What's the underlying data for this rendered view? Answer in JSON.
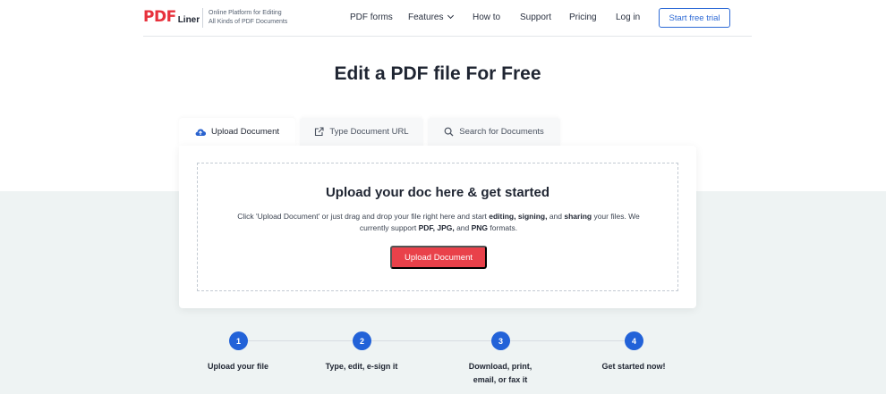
{
  "header": {
    "logo_pdf": "PDF",
    "logo_liner": "Liner",
    "tagline_line1": "Online Platform for Editing",
    "tagline_line2": "All Kinds of PDF Documents",
    "nav": [
      {
        "label": "PDF forms"
      },
      {
        "label": "Features"
      },
      {
        "label": "How to"
      },
      {
        "label": "Support"
      },
      {
        "label": "Pricing"
      },
      {
        "label": "Log in"
      }
    ],
    "cta_label": "Start free trial"
  },
  "hero": {
    "title": "Edit a PDF file For Free"
  },
  "tabs": [
    {
      "label": "Upload Document",
      "icon": "cloud-upload-icon",
      "active": true
    },
    {
      "label": "Type Document URL",
      "icon": "external-link-icon",
      "active": false
    },
    {
      "label": "Search for Documents",
      "icon": "search-icon",
      "active": false
    }
  ],
  "upload": {
    "title": "Upload your doc here & get started",
    "text_1": "Click 'Upload Document' or just drag and drop your file right here and start ",
    "bold_editing": "editing,",
    "bold_signing": "signing,",
    "text_and": " and ",
    "bold_sharing": "sharing",
    "text_2": " your files. We currently support ",
    "bold_pdf": "PDF, JPG,",
    "text_3": " and ",
    "bold_png": "PNG",
    "text_4": " formats.",
    "button_label": "Upload Document"
  },
  "steps": [
    {
      "number": "1",
      "label": "Upload your file"
    },
    {
      "number": "2",
      "label": "Type, edit, e-sign it"
    },
    {
      "number": "3",
      "label": "Download, print, email, or fax it"
    },
    {
      "number": "4",
      "label": "Get started now!"
    }
  ],
  "colors": {
    "brand_red": "#e7313c",
    "button_red": "#e9414a",
    "accent_blue": "#2262d8",
    "lower_bg": "#eef3f3"
  }
}
